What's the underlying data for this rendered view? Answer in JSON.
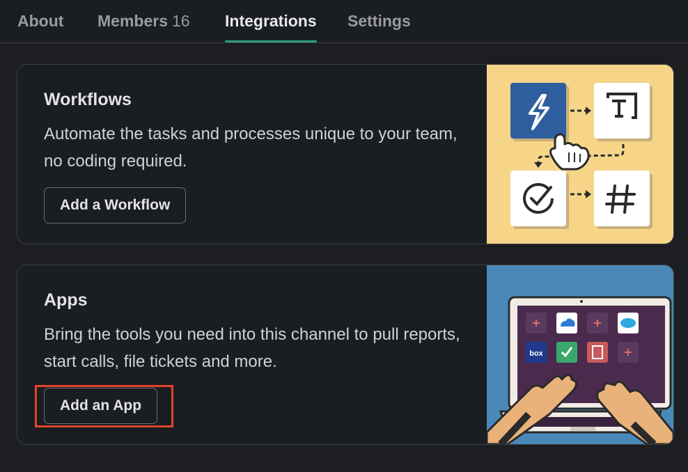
{
  "tabs": [
    {
      "label": "About",
      "count": ""
    },
    {
      "label": "Members",
      "count": "16"
    },
    {
      "label": "Integrations",
      "count": ""
    },
    {
      "label": "Settings",
      "count": ""
    }
  ],
  "active_tab": "Integrations",
  "workflows": {
    "title": "Workflows",
    "description": "Automate the tasks and processes unique to your team, no coding required.",
    "button_label": "Add a Workflow",
    "illustration_icons": [
      "lightning-icon",
      "text-icon",
      "checkmark-circle-icon",
      "hash-icon",
      "pointer-hand-icon"
    ]
  },
  "apps": {
    "title": "Apps",
    "description": "Bring the tools you need into this channel to pull reports, start calls, file tickets and more.",
    "button_label": "Add an App",
    "illustration_labels": [
      "box"
    ]
  },
  "colors": {
    "accent_underline": "#2e9e79",
    "highlight_box": "#e1442b",
    "workflow_bg": "#f6d588",
    "apps_bg": "#4a88b9"
  }
}
